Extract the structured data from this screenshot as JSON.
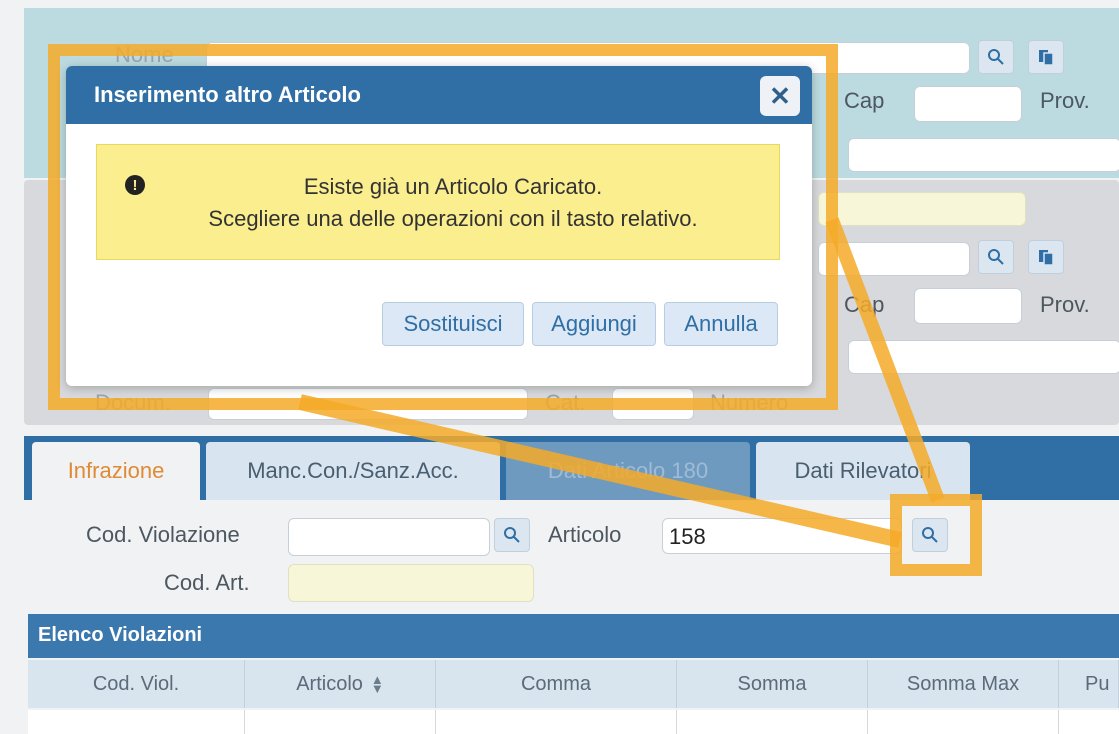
{
  "background_form": {
    "nome_label": "Nome",
    "cap_label": "Cap",
    "prov_label": "Prov.",
    "cap_label_2": "Cap",
    "prov_label_2": "Prov.",
    "docum_label": "Docum.",
    "cat_label": "Cat.",
    "numero_label": "Numero"
  },
  "tabs": [
    {
      "label": "Infrazione"
    },
    {
      "label": "Manc.Con./Sanz.Acc."
    },
    {
      "label": "Dati Articolo 180"
    },
    {
      "label": "Dati Rilevatori"
    }
  ],
  "form": {
    "cod_violazione_label": "Cod. Violazione",
    "cod_violazione_value": "",
    "articolo_label": "Articolo",
    "articolo_value": "158",
    "cod_art_label": "Cod. Art.",
    "cod_art_value": ""
  },
  "grid": {
    "title": "Elenco Violazioni",
    "columns": [
      "Cod. Viol.",
      "Articolo",
      "Comma",
      "Somma",
      "Somma Max",
      "Pu"
    ],
    "sort_icon": "sort-icon"
  },
  "dialog": {
    "title": "Inserimento altro Articolo",
    "close_icon": "close-icon",
    "warning_line1": "Esiste già un Articolo Caricato.",
    "warning_line2": "Scegliere una delle operazioni con il tasto relativo.",
    "buttons": {
      "sostituisci": "Sostituisci",
      "aggiungi": "Aggiungi",
      "annulla": "Annulla"
    }
  },
  "colors": {
    "primary": "#2f6fa5",
    "accent_tab": "#e08a33",
    "warning_bg": "#faee8f",
    "highlight": "#f5aa28"
  }
}
